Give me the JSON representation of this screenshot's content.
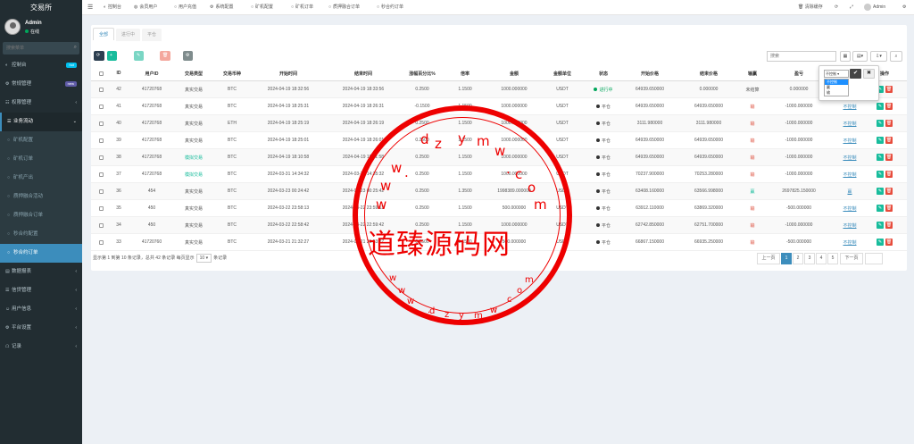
{
  "brand": "交易所",
  "user": {
    "name": "Admin",
    "status": "在线"
  },
  "sidebar_search": {
    "placeholder": "搜索菜单"
  },
  "menu": [
    {
      "icon": "dashboard-icon",
      "glyph": "◐",
      "label": "控制台",
      "badge": "hot",
      "badge_color": "#00c0ef",
      "type": "main"
    },
    {
      "icon": "settings-icon",
      "glyph": "⚙",
      "label": "常规管理",
      "badge": "new",
      "badge_color": "#605ca8",
      "type": "main"
    },
    {
      "icon": "users-icon",
      "glyph": "☷",
      "label": "权限管理",
      "arrow": "‹",
      "type": "main"
    },
    {
      "icon": "bars-icon",
      "glyph": "☰",
      "label": "业务流动",
      "arrow": "⌄",
      "type": "open"
    },
    {
      "icon": "circle-icon",
      "glyph": "○",
      "label": "矿机配置",
      "type": "sub"
    },
    {
      "icon": "circle-icon",
      "glyph": "○",
      "label": "矿机订单",
      "type": "sub"
    },
    {
      "icon": "circle-icon",
      "glyph": "○",
      "label": "矿机产出",
      "type": "sub"
    },
    {
      "icon": "circle-icon",
      "glyph": "○",
      "label": "质押融合活动",
      "type": "sub"
    },
    {
      "icon": "circle-icon",
      "glyph": "○",
      "label": "质押融合订单",
      "type": "sub"
    },
    {
      "icon": "circle-icon",
      "glyph": "○",
      "label": "秒合约配置",
      "type": "sub"
    },
    {
      "icon": "circle-icon",
      "glyph": "○",
      "label": "秒合约订单",
      "type": "active"
    },
    {
      "icon": "chart-icon",
      "glyph": "▤",
      "label": "数据报表",
      "arrow": "‹",
      "type": "main"
    },
    {
      "icon": "list-icon",
      "glyph": "☰",
      "label": "信贷管理",
      "arrow": "‹",
      "type": "main"
    },
    {
      "icon": "user-icon",
      "glyph": "☺",
      "label": "用户信息",
      "arrow": "‹",
      "type": "main"
    },
    {
      "icon": "gear-icon",
      "glyph": "⚙",
      "label": "平台设置",
      "arrow": "‹",
      "type": "main"
    },
    {
      "icon": "record-icon",
      "glyph": "☖",
      "label": "记录",
      "arrow": "‹",
      "type": "main"
    }
  ],
  "topnav": [
    {
      "icon": "dashboard-icon",
      "glyph": "◐",
      "label": "控制台"
    },
    {
      "icon": "user-icon",
      "glyph": "◍",
      "label": "会员用户"
    },
    {
      "icon": "circle-icon",
      "glyph": "○",
      "label": "用户充值"
    },
    {
      "icon": "gear-icon",
      "glyph": "⚙",
      "label": "系统配置"
    },
    {
      "icon": "circle-icon",
      "glyph": "○",
      "label": "矿机配置"
    },
    {
      "icon": "circle-icon",
      "glyph": "○",
      "label": "矿机订单"
    },
    {
      "icon": "circle-icon",
      "glyph": "○",
      "label": "质押融合订单"
    },
    {
      "icon": "circle-icon",
      "glyph": "○",
      "label": "秒合约订单"
    }
  ],
  "topright": {
    "clear_cache": "清除缓存",
    "admin": "Admin"
  },
  "tabs": [
    "全部",
    "进行中",
    "平仓"
  ],
  "toolbar": {
    "add": "添加",
    "edit": "编辑",
    "delete": "删除",
    "more": "显示"
  },
  "search": {
    "placeholder": "搜索"
  },
  "columns": [
    "ID",
    "用户ID",
    "交易类型",
    "交易币种",
    "开始时间",
    "结束时间",
    "涨幅百分比%",
    "倍率",
    "金额",
    "金额单位",
    "状态",
    "开始价格",
    "结束价格",
    "输赢",
    "盈亏",
    "控制",
    "操作"
  ],
  "rows": [
    {
      "id": "42",
      "uid": "41720768",
      "type": "真实交易",
      "coin": "BTC",
      "start": "2024-04-19 18:32:56",
      "end": "2024-04-19 18:33:56",
      "pct": "0.2500",
      "rate": "1.1500",
      "amount": "1000.000000",
      "unit": "USDT",
      "status": "进行中",
      "status_color": "#00a65a",
      "sprice": "64939.650000",
      "eprice": "0.000000",
      "winlose": "未结算",
      "pl": "0.000000",
      "ctrl": "不控制"
    },
    {
      "id": "41",
      "uid": "41720768",
      "type": "真实交易",
      "coin": "BTC",
      "start": "2024-04-19 18:25:31",
      "end": "2024-04-19 18:26:31",
      "pct": "-0.1500",
      "rate": "1.1500",
      "amount": "1000.000000",
      "unit": "USDT",
      "status": "平仓",
      "status_color": "#333",
      "sprice": "64939.650000",
      "eprice": "64939.650000",
      "winlose": "输",
      "pl": "-1000.000000",
      "ctrl": "不控制"
    },
    {
      "id": "40",
      "uid": "41720768",
      "type": "真实交易",
      "coin": "ETH",
      "start": "2024-04-19 18:25:19",
      "end": "2024-04-19 18:26:19",
      "pct": "0.2500",
      "rate": "1.1500",
      "amount": "1000.000000",
      "unit": "USDT",
      "status": "平仓",
      "status_color": "#333",
      "sprice": "3111.980000",
      "eprice": "3111.980000",
      "winlose": "输",
      "pl": "-1000.000000",
      "ctrl": "不控制"
    },
    {
      "id": "39",
      "uid": "41720768",
      "type": "真实交易",
      "coin": "BTC",
      "start": "2024-04-19 18:25:01",
      "end": "2024-04-19 18:26:01",
      "pct": "0.2500",
      "rate": "1.1500",
      "amount": "1000.000000",
      "unit": "USDT",
      "status": "平仓",
      "status_color": "#333",
      "sprice": "64939.650000",
      "eprice": "64939.650000",
      "winlose": "输",
      "pl": "-1000.000000",
      "ctrl": "不控制"
    },
    {
      "id": "38",
      "uid": "41720768",
      "type": "模拟交易",
      "coin": "BTC",
      "start": "2024-04-19 18:10:58",
      "end": "2024-04-19 18:11:58",
      "pct": "0.2500",
      "rate": "1.1500",
      "amount": "1000.000000",
      "unit": "USDT",
      "status": "平仓",
      "status_color": "#333",
      "sprice": "64939.650000",
      "eprice": "64939.650000",
      "winlose": "输",
      "pl": "-1000.000000",
      "ctrl": "不控制"
    },
    {
      "id": "37",
      "uid": "41720768",
      "type": "模拟交易",
      "coin": "BTC",
      "start": "2024-03-31 14:34:32",
      "end": "2024-03-31 14:35:32",
      "pct": "0.2500",
      "rate": "1.1500",
      "amount": "1000.000000",
      "unit": "USDT",
      "status": "平仓",
      "status_color": "#333",
      "sprice": "70237.900000",
      "eprice": "70253.280000",
      "winlose": "输",
      "pl": "-1000.000000",
      "ctrl": "不控制"
    },
    {
      "id": "36",
      "uid": "454",
      "type": "真实交易",
      "coin": "BTC",
      "start": "2024-03-23 00:24:42",
      "end": "2024-03-23 00:25:42",
      "pct": "0.2500",
      "rate": "1.3500",
      "amount": "1998389.000000",
      "unit": "USDT",
      "status": "平仓",
      "status_color": "#333",
      "sprice": "63408.160000",
      "eprice": "63566.998000",
      "winlose": "赢",
      "pl": "2697825.150000",
      "ctrl": "赢"
    },
    {
      "id": "35",
      "uid": "450",
      "type": "真实交易",
      "coin": "BTC",
      "start": "2024-03-22 23:58:13",
      "end": "2024-03-22 23:59:13",
      "pct": "0.2500",
      "rate": "1.1500",
      "amount": "500.000000",
      "unit": "USDT",
      "status": "平仓",
      "status_color": "#333",
      "sprice": "63912.110000",
      "eprice": "63869.320000",
      "winlose": "输",
      "pl": "-500.000000",
      "ctrl": "不控制"
    },
    {
      "id": "34",
      "uid": "450",
      "type": "真实交易",
      "coin": "BTC",
      "start": "2024-03-22 22:58:42",
      "end": "2024-03-22 22:59:42",
      "pct": "0.2500",
      "rate": "1.1500",
      "amount": "1000.000000",
      "unit": "USDT",
      "status": "平仓",
      "status_color": "#333",
      "sprice": "62742.850000",
      "eprice": "62751.700000",
      "winlose": "输",
      "pl": "-1000.000000",
      "ctrl": "不控制"
    },
    {
      "id": "33",
      "uid": "41720760",
      "type": "真实交易",
      "coin": "BTC",
      "start": "2024-03-21 21:32:27",
      "end": "2024-03-21 21:53:27",
      "pct": "0.2500",
      "rate": "1.1500",
      "amount": "500.000000",
      "unit": "USDT",
      "status": "平仓",
      "status_color": "#333",
      "sprice": "66867.150000",
      "eprice": "66935.250000",
      "winlose": "输",
      "pl": "-500.000000",
      "ctrl": "不控制"
    }
  ],
  "popover": {
    "selected": "不控制",
    "options": [
      "不控制",
      "赢",
      "输"
    ],
    "ok": "✔",
    "cancel": "✖"
  },
  "pager": {
    "info_prefix": "显示第 1 到第 10 条记录，总共 42 条记录 每页显示",
    "size": "10",
    "info_suffix": "条记录",
    "prev": "上一页",
    "pages": [
      "1",
      "2",
      "3",
      "4",
      "5"
    ],
    "next": "下一页"
  },
  "watermark": {
    "main": "道臻源码网",
    "chars_outer": [
      "w",
      "w",
      "w",
      ".",
      "d",
      "z",
      "y",
      "m",
      "w",
      ".",
      "c",
      "o",
      "m"
    ],
    "chars_inner": [
      "w",
      "w",
      "w",
      ".",
      "d",
      "z",
      "y",
      "m",
      "w",
      ".",
      "c",
      "o",
      "m"
    ]
  },
  "colors": {
    "sidebar_bg": "#222d32",
    "accent": "#3c8dbc",
    "add_green": "#18bc9c",
    "edit_green": "#2ecc71",
    "delete_red": "#f39c92",
    "watermark_red": "#e00"
  }
}
